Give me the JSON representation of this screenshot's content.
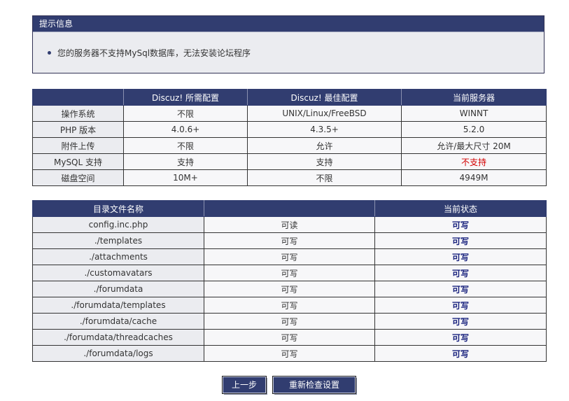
{
  "notice": {
    "title": "提示信息",
    "message": "您的服务器不支持MySql数据库，无法安装论坛程序"
  },
  "env_table": {
    "headers": [
      "",
      "Discuz! 所需配置",
      "Discuz! 最佳配置",
      "当前服务器"
    ],
    "rows": [
      {
        "item": "操作系统",
        "required": "不限",
        "best": "UNIX/Linux/FreeBSD",
        "current": "WINNT"
      },
      {
        "item": "PHP 版本",
        "required": "4.0.6+",
        "best": "4.3.5+",
        "current": "5.2.0"
      },
      {
        "item": "附件上传",
        "required": "不限",
        "best": "允许",
        "current": "允许/最大尺寸 20M"
      },
      {
        "item": "MySQL 支持",
        "required": "支持",
        "best": "支持",
        "current": "不支持"
      },
      {
        "item": "磁盘空间",
        "required": "10M+",
        "best": "不限",
        "current": "4949M"
      }
    ],
    "error_color": "#d40000"
  },
  "dir_table": {
    "headers": [
      "目录文件名称",
      "",
      "当前状态"
    ],
    "rows": [
      {
        "name": "config.inc.php",
        "required": "可读",
        "status": "可写"
      },
      {
        "name": "./templates",
        "required": "可写",
        "status": "可写"
      },
      {
        "name": "./attachments",
        "required": "可写",
        "status": "可写"
      },
      {
        "name": "./customavatars",
        "required": "可写",
        "status": "可写"
      },
      {
        "name": "./forumdata",
        "required": "可写",
        "status": "可写"
      },
      {
        "name": "./forumdata/templates",
        "required": "可写",
        "status": "可写"
      },
      {
        "name": "./forumdata/cache",
        "required": "可写",
        "status": "可写"
      },
      {
        "name": "./forumdata/threadcaches",
        "required": "可写",
        "status": "可写"
      },
      {
        "name": "./forumdata/logs",
        "required": "可写",
        "status": "可写"
      }
    ]
  },
  "buttons": {
    "prev_label": "上一步",
    "recheck_label": "重新检查设置"
  },
  "colors": {
    "header_bg": "#313d70",
    "panel_bg": "#ebecf0",
    "status_ok": "#1a237e"
  }
}
